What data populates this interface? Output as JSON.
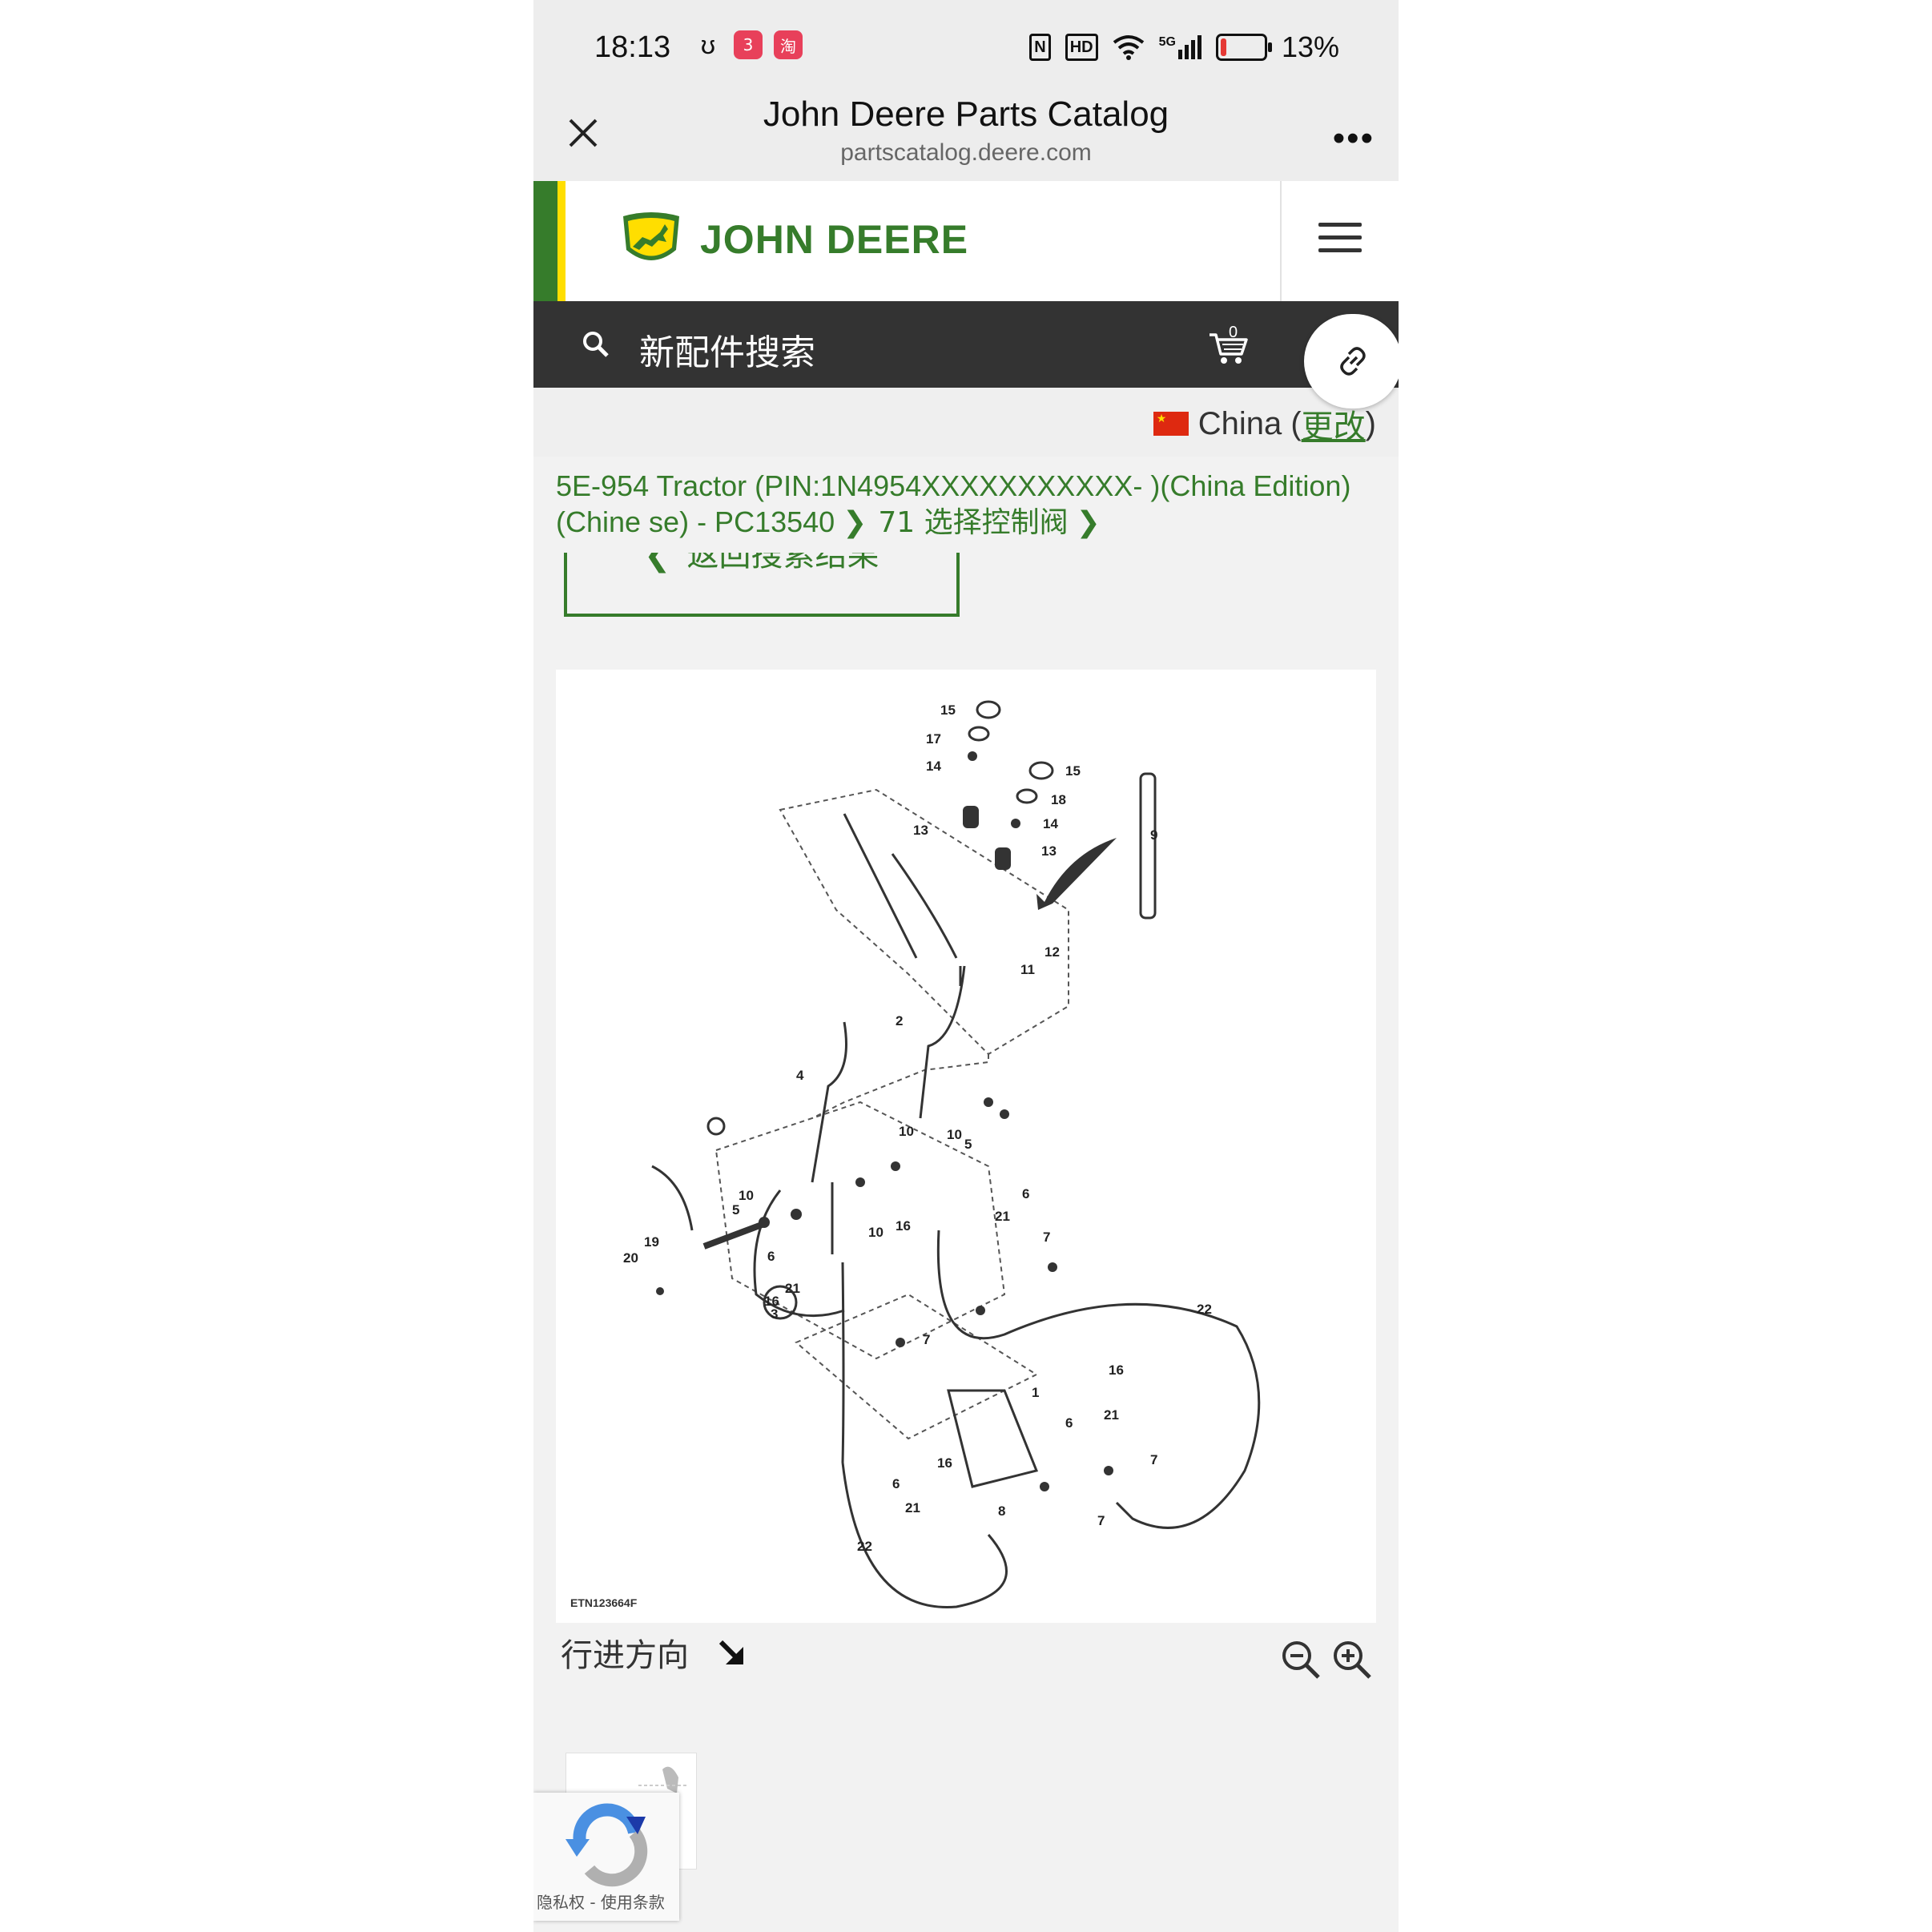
{
  "status_bar": {
    "time": "18:13",
    "app_badges": [
      "3",
      "淘"
    ],
    "nfc": "N",
    "hd": "HD",
    "network": "5G",
    "battery_level": 0.13,
    "battery": "13%"
  },
  "browser": {
    "title": "John Deere Parts Catalog",
    "url": "partscatalog.deere.com",
    "more": "•••"
  },
  "brand": {
    "name": "JOHN DEERE",
    "green": "#367c2b",
    "yellow": "#ffde00"
  },
  "search": {
    "placeholder": "新配件搜索",
    "cart_count": "0"
  },
  "country": {
    "name": "China (",
    "change": "更改",
    "close_paren": ")"
  },
  "breadcrumb": {
    "machine": "5E-954 Tractor (PIN:1N4954XXXXXXXXXXX- )(China Edition)(Chine se) - PC13540",
    "section": "71 选择控制阀"
  },
  "back_button": {
    "label": "返回搜索结果"
  },
  "diagram": {
    "code": "ETN123664F",
    "callouts": [
      "15",
      "17",
      "14",
      "15",
      "18",
      "14",
      "13",
      "13",
      "9",
      "12",
      "11",
      "2",
      "4",
      "5",
      "10",
      "10",
      "10",
      "6",
      "5",
      "10",
      "16",
      "21",
      "19",
      "20",
      "6",
      "21",
      "16",
      "3",
      "7",
      "7",
      "22",
      "16",
      "21",
      "1",
      "6",
      "7",
      "16",
      "6",
      "21",
      "8",
      "7",
      "22"
    ]
  },
  "travel_direction": {
    "label": "行进方向"
  },
  "recaptcha": {
    "terms": "隐私权 - 使用条款"
  }
}
